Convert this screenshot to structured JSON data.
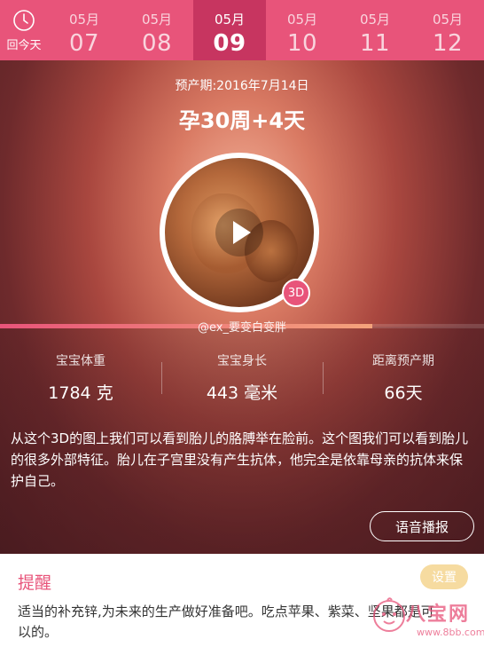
{
  "datebar": {
    "today_label": "回今天",
    "dates": [
      {
        "month": "05月",
        "day": "07",
        "active": false
      },
      {
        "month": "05月",
        "day": "08",
        "active": false
      },
      {
        "month": "05月",
        "day": "09",
        "active": true
      },
      {
        "month": "05月",
        "day": "10",
        "active": false
      },
      {
        "month": "05月",
        "day": "11",
        "active": false
      },
      {
        "month": "05月",
        "day": "12",
        "active": false
      }
    ]
  },
  "hero": {
    "due_date": "预产期:2016年7月14日",
    "week": "孕30周+4天",
    "badge": "3D",
    "watermark": "@ex_要变白变胖",
    "progress": 0.77
  },
  "stats": [
    {
      "label": "宝宝体重",
      "value": "1784 克"
    },
    {
      "label": "宝宝身长",
      "value": "443 毫米"
    },
    {
      "label": "距离预产期",
      "value": "66天"
    }
  ],
  "description": "从这个3D的图上我们可以看到胎儿的胳膊举在脸前。这个图我们可以看到胎儿的很多外部特征。胎儿在子宫里没有产生抗体，他完全是依靠母亲的抗体来保护自己。",
  "voice_button": "语音播报",
  "reminder": {
    "title": "提醒",
    "settings_label": "设置",
    "text": "适当的补充锌,为未来的生产做好准备吧。吃点苹果、紫菜、坚果都是可以的。"
  },
  "logo": {
    "text": "八宝网",
    "url": "www.8bb.com"
  },
  "colors": {
    "accent": "#e8547a",
    "active_date": "#c73560",
    "settings_button": "#f6dba0"
  }
}
